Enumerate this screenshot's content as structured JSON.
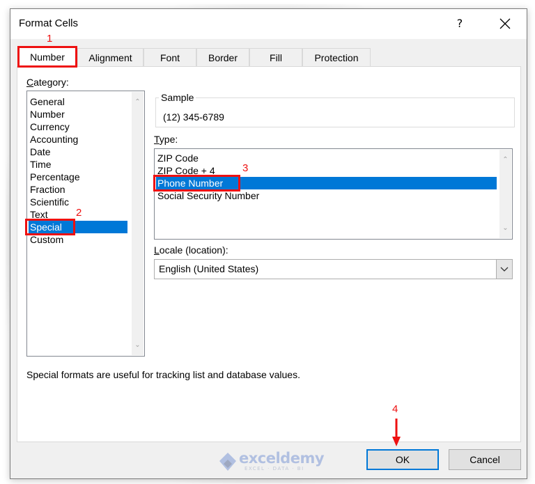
{
  "window": {
    "title": "Format Cells",
    "help_label": "?",
    "close_icon": "close-icon"
  },
  "tabs": [
    {
      "label": "Number",
      "active": true
    },
    {
      "label": "Alignment",
      "active": false
    },
    {
      "label": "Font",
      "active": false
    },
    {
      "label": "Border",
      "active": false
    },
    {
      "label": "Fill",
      "active": false
    },
    {
      "label": "Protection",
      "active": false
    }
  ],
  "category": {
    "label_first": "C",
    "label_rest": "ategory:",
    "items": [
      "General",
      "Number",
      "Currency",
      "Accounting",
      "Date",
      "Time",
      "Percentage",
      "Fraction",
      "Scientific",
      "Text",
      "Special",
      "Custom"
    ],
    "selected": "Special"
  },
  "sample": {
    "label": "Sample",
    "value": "(12) 345-6789"
  },
  "type": {
    "label_first": "T",
    "label_rest": "ype:",
    "items": [
      "ZIP Code",
      "ZIP Code + 4",
      "Phone Number",
      "Social Security Number"
    ],
    "selected": "Phone Number"
  },
  "locale": {
    "label_first": "L",
    "label_rest": "ocale (location):",
    "value": "English (United States)"
  },
  "description": "Special formats are useful for tracking list and database values.",
  "buttons": {
    "ok": "OK",
    "cancel": "Cancel"
  },
  "annotations": {
    "step1": "1",
    "step2": "2",
    "step3": "3",
    "step4": "4",
    "color": "#ee1111"
  },
  "watermark": {
    "brand": "exceldemy",
    "tagline": "EXCEL · DATA · BI"
  },
  "colors": {
    "selection": "#0078d7",
    "dialog_bg": "#f0f0f0"
  }
}
